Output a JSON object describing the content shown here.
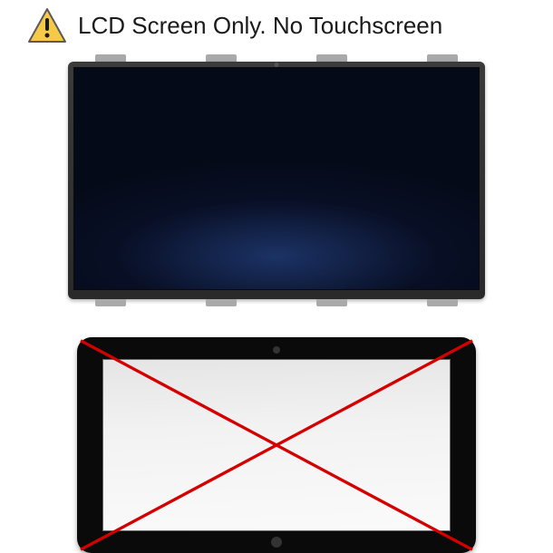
{
  "header": {
    "warning_icon": "warning",
    "text": "LCD Screen Only. No Touchscreen"
  },
  "colors": {
    "warning_fill": "#f7c948",
    "warning_stroke": "#555555",
    "cross_stroke": "#d40000"
  }
}
